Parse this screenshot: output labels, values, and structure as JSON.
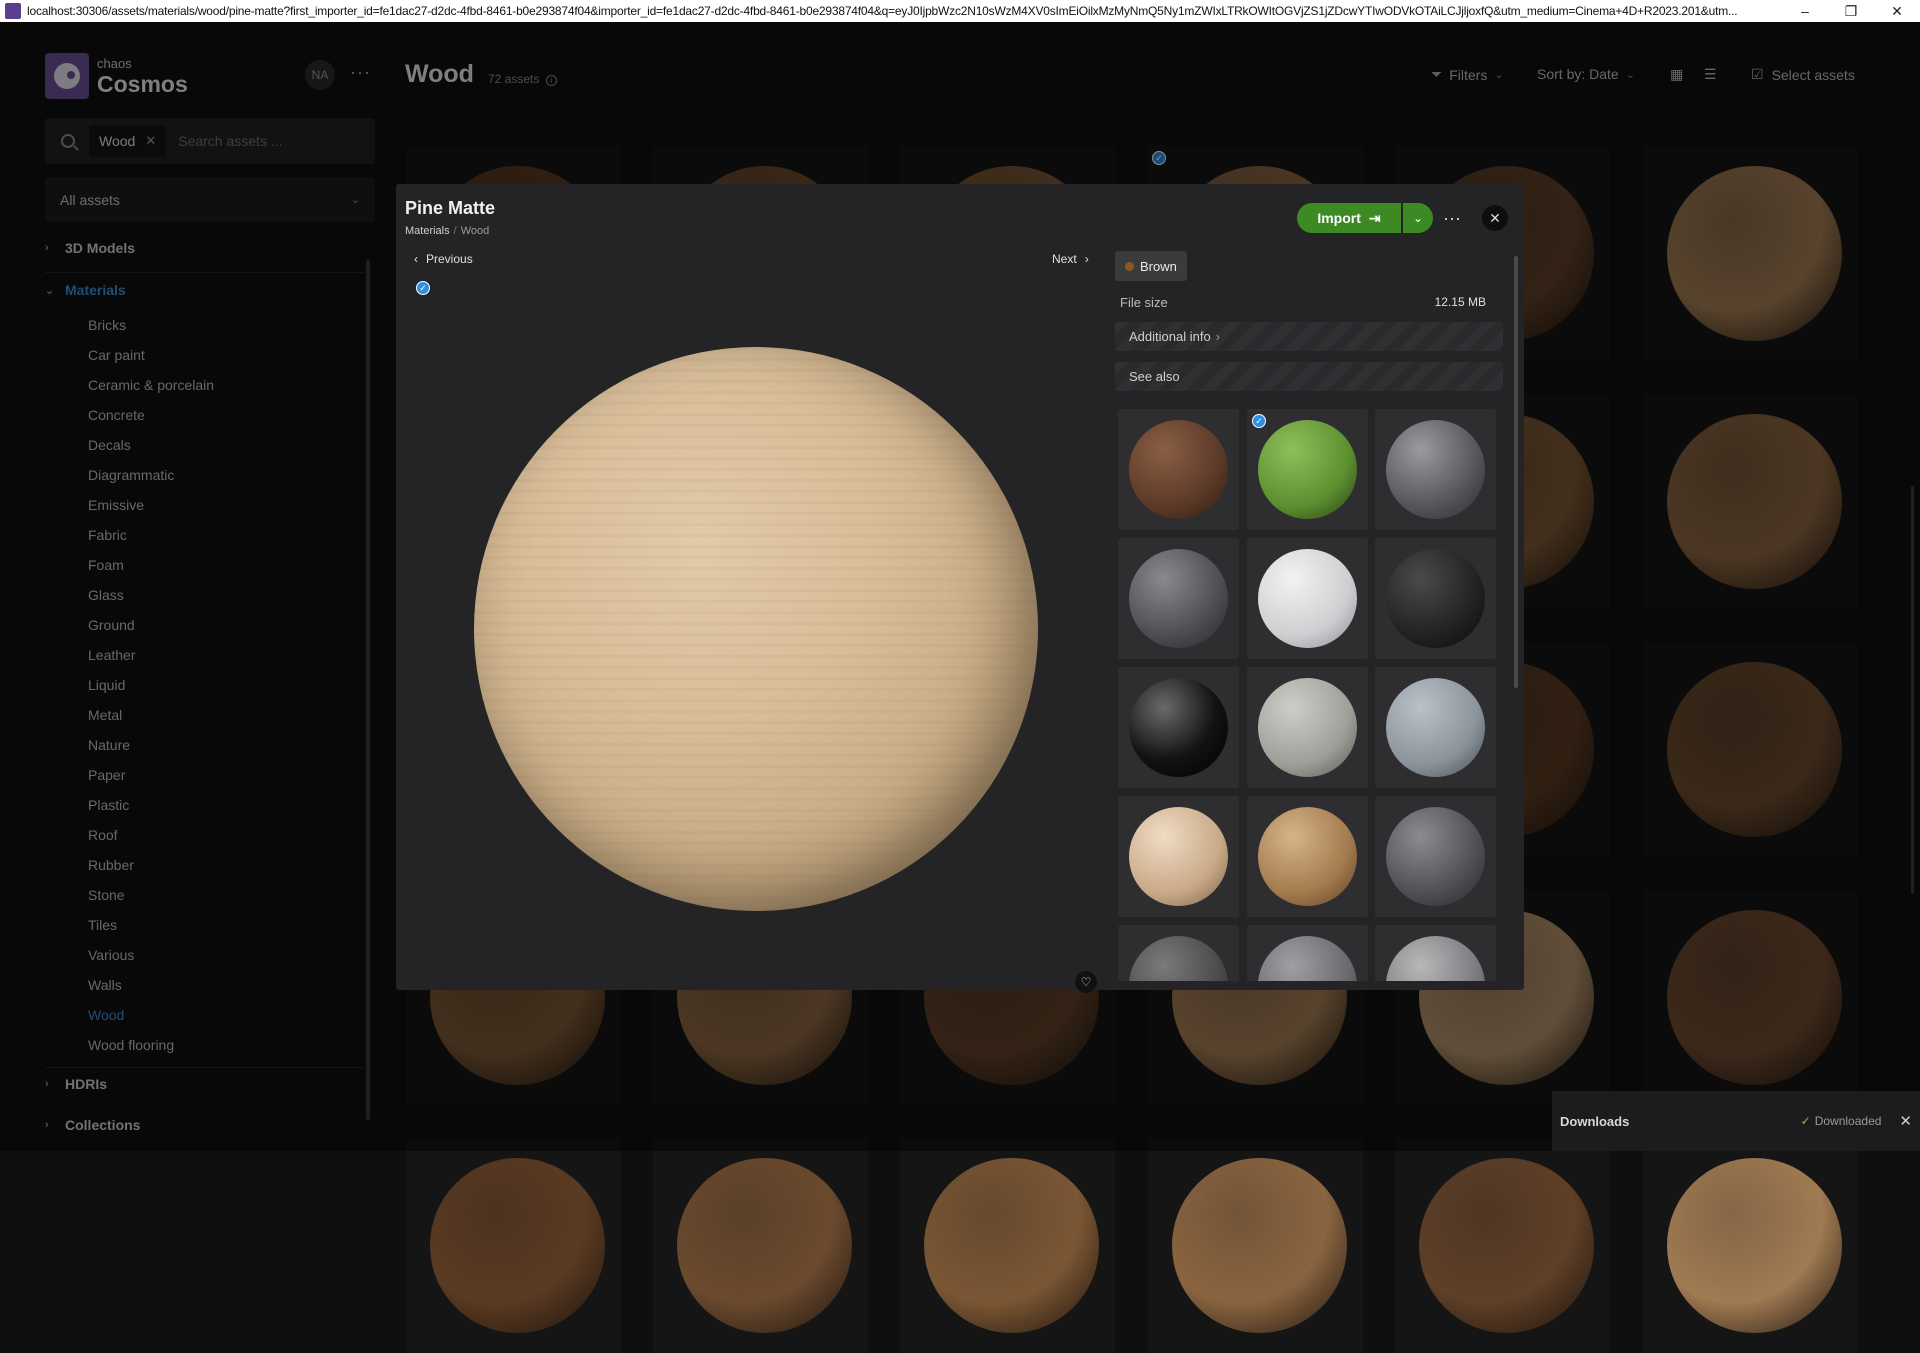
{
  "browser": {
    "url": "localhost:30306/assets/materials/wood/pine-matte?first_importer_id=fe1dac27-d2dc-4fbd-8461-b0e293874f04&importer_id=fe1dac27-d2dc-4fbd-8461-b0e293874f04&q=eyJ0IjpbWzc2N10sWzM4XV0sImEiOilxMzMyNmQ5Ny1mZWIxLTRkOWItOGVjZS1jZDcwYTIwODVkOTAiLCJjljoxfQ&utm_medium=Cinema+4D+R2023.201&utm...",
    "minimize": "–",
    "restore": "❐",
    "close": "✕"
  },
  "brand": {
    "small": "chaos",
    "big": "Cosmos"
  },
  "user": {
    "initials": "NA"
  },
  "search": {
    "chip": "Wood",
    "placeholder": "Search assets ..."
  },
  "filter_select": {
    "value": "All assets"
  },
  "sidebar": {
    "categories": [
      {
        "label": "3D Models"
      },
      {
        "label": "Materials"
      },
      {
        "label": "HDRIs"
      },
      {
        "label": "Collections"
      }
    ],
    "materials": [
      "Bricks",
      "Car paint",
      "Ceramic & porcelain",
      "Concrete",
      "Decals",
      "Diagrammatic",
      "Emissive",
      "Fabric",
      "Foam",
      "Glass",
      "Ground",
      "Leather",
      "Liquid",
      "Metal",
      "Nature",
      "Paper",
      "Plastic",
      "Roof",
      "Rubber",
      "Stone",
      "Tiles",
      "Various",
      "Walls",
      "Wood",
      "Wood flooring"
    ]
  },
  "header": {
    "title": "Wood",
    "count": "72 assets",
    "filters": "Filters",
    "sort": "Sort by: Date",
    "select": "Select assets"
  },
  "modal": {
    "title": "Pine Matte",
    "crumb_1": "Materials",
    "crumb_sep": "/",
    "crumb_2": "Wood",
    "previous": "Previous",
    "next": "Next",
    "import": "Import",
    "tag": "Brown",
    "file_size_label": "File size",
    "file_size_value": "12.15 MB",
    "additional_info": "Additional info",
    "see_also": "See also"
  },
  "downloads": {
    "title": "Downloads",
    "status": "Downloaded"
  },
  "colors": {
    "accent_blue": "#3b8fd4",
    "import_green": "#3d8a24"
  }
}
